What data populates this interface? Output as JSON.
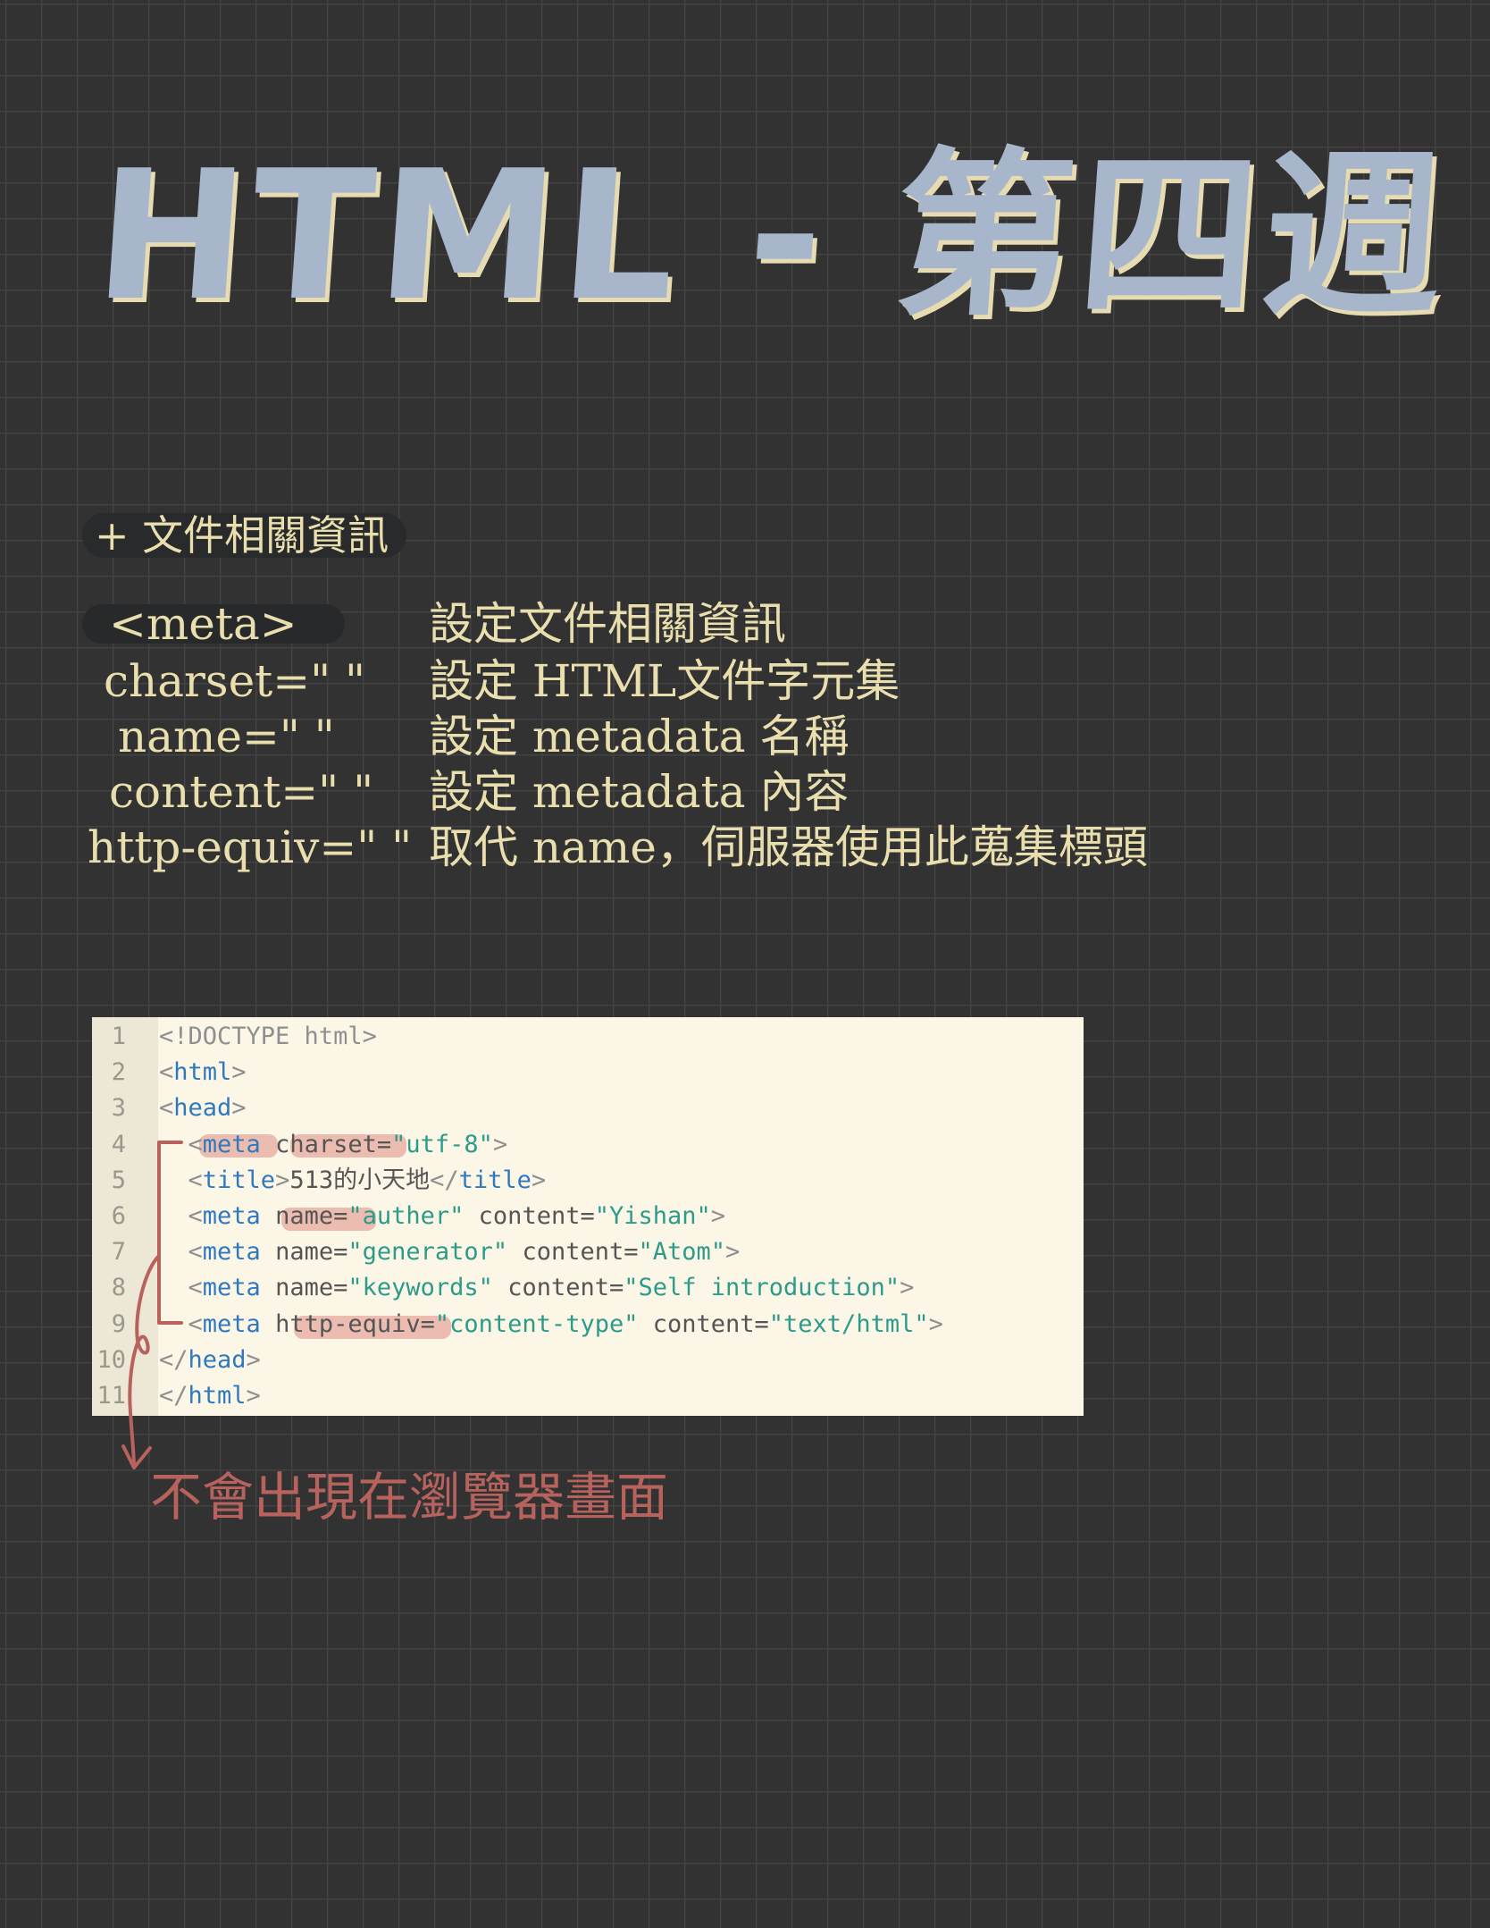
{
  "title": "HTML - 第四週",
  "section": {
    "heading": "+ 文件相關資訊"
  },
  "attributes": [
    {
      "name": "<meta>",
      "desc": "設定文件相關資訊"
    },
    {
      "name": "charset=\" \"",
      "desc": "設定 HTML文件字元集"
    },
    {
      "name": "name=\" \"",
      "desc": "設定 metadata 名稱"
    },
    {
      "name": "content=\" \"",
      "desc": "設定 metadata 內容"
    },
    {
      "name": "http-equiv=\" \"",
      "desc": "取代 name，伺服器使用此蒐集標頭"
    }
  ],
  "code": {
    "line_numbers": [
      "1",
      "2",
      "3",
      "4",
      "5",
      "6",
      "7",
      "8",
      "9",
      "10",
      "11"
    ],
    "lines": [
      {
        "tokens": [
          {
            "t": "doctype",
            "v": "<!DOCTYPE html>"
          }
        ]
      },
      {
        "tokens": [
          {
            "t": "punct",
            "v": "<"
          },
          {
            "t": "tag",
            "v": "html"
          },
          {
            "t": "punct",
            "v": ">"
          }
        ]
      },
      {
        "tokens": [
          {
            "t": "punct",
            "v": "<"
          },
          {
            "t": "tag",
            "v": "head"
          },
          {
            "t": "punct",
            "v": ">"
          }
        ]
      },
      {
        "tokens": [
          {
            "t": "text",
            "v": "  "
          },
          {
            "t": "punct",
            "v": "<"
          },
          {
            "t": "tag",
            "v": "meta"
          },
          {
            "t": "text",
            "v": " "
          },
          {
            "t": "attr",
            "v": "charset="
          },
          {
            "t": "str",
            "v": "\"utf-8\""
          },
          {
            "t": "punct",
            "v": ">"
          }
        ]
      },
      {
        "tokens": [
          {
            "t": "text",
            "v": "  "
          },
          {
            "t": "punct",
            "v": "<"
          },
          {
            "t": "tag",
            "v": "title"
          },
          {
            "t": "punct",
            "v": ">"
          },
          {
            "t": "text",
            "v": "513的小天地"
          },
          {
            "t": "punct",
            "v": "</"
          },
          {
            "t": "tag",
            "v": "title"
          },
          {
            "t": "punct",
            "v": ">"
          }
        ]
      },
      {
        "tokens": [
          {
            "t": "text",
            "v": "  "
          },
          {
            "t": "punct",
            "v": "<"
          },
          {
            "t": "tag",
            "v": "meta"
          },
          {
            "t": "text",
            "v": " "
          },
          {
            "t": "attr",
            "v": "name="
          },
          {
            "t": "str",
            "v": "\"auther\""
          },
          {
            "t": "text",
            "v": " "
          },
          {
            "t": "attr",
            "v": "content="
          },
          {
            "t": "str",
            "v": "\"Yishan\""
          },
          {
            "t": "punct",
            "v": ">"
          }
        ]
      },
      {
        "tokens": [
          {
            "t": "text",
            "v": "  "
          },
          {
            "t": "punct",
            "v": "<"
          },
          {
            "t": "tag",
            "v": "meta"
          },
          {
            "t": "text",
            "v": " "
          },
          {
            "t": "attr",
            "v": "name="
          },
          {
            "t": "str",
            "v": "\"generator\""
          },
          {
            "t": "text",
            "v": " "
          },
          {
            "t": "attr",
            "v": "content="
          },
          {
            "t": "str",
            "v": "\"Atom\""
          },
          {
            "t": "punct",
            "v": ">"
          }
        ]
      },
      {
        "tokens": [
          {
            "t": "text",
            "v": "  "
          },
          {
            "t": "punct",
            "v": "<"
          },
          {
            "t": "tag",
            "v": "meta"
          },
          {
            "t": "text",
            "v": " "
          },
          {
            "t": "attr",
            "v": "name="
          },
          {
            "t": "str",
            "v": "\"keywords\""
          },
          {
            "t": "text",
            "v": " "
          },
          {
            "t": "attr",
            "v": "content="
          },
          {
            "t": "str",
            "v": "\"Self introduction\""
          },
          {
            "t": "punct",
            "v": ">"
          }
        ]
      },
      {
        "tokens": [
          {
            "t": "text",
            "v": "  "
          },
          {
            "t": "punct",
            "v": "<"
          },
          {
            "t": "tag",
            "v": "meta"
          },
          {
            "t": "text",
            "v": " "
          },
          {
            "t": "attr",
            "v": "http-equiv="
          },
          {
            "t": "str",
            "v": "\"content-type\""
          },
          {
            "t": "text",
            "v": " "
          },
          {
            "t": "attr",
            "v": "content="
          },
          {
            "t": "str",
            "v": "\"text/html\""
          },
          {
            "t": "punct",
            "v": ">"
          }
        ]
      },
      {
        "tokens": [
          {
            "t": "punct",
            "v": "</"
          },
          {
            "t": "tag",
            "v": "head"
          },
          {
            "t": "punct",
            "v": ">"
          }
        ]
      },
      {
        "tokens": [
          {
            "t": "punct",
            "v": "</"
          },
          {
            "t": "tag",
            "v": "html"
          },
          {
            "t": "punct",
            "v": ">"
          }
        ]
      }
    ]
  },
  "annotation": "不會出現在瀏覽器畫面",
  "colors": {
    "background": "#323232",
    "grid": "#434343",
    "title": "#a7b6cb",
    "title_shadow": "#e6dbb1",
    "notes": "#e9dfae",
    "annotation": "#b7625c",
    "code_bg": "#fcf6e6",
    "highlight": "#dc8c82"
  }
}
